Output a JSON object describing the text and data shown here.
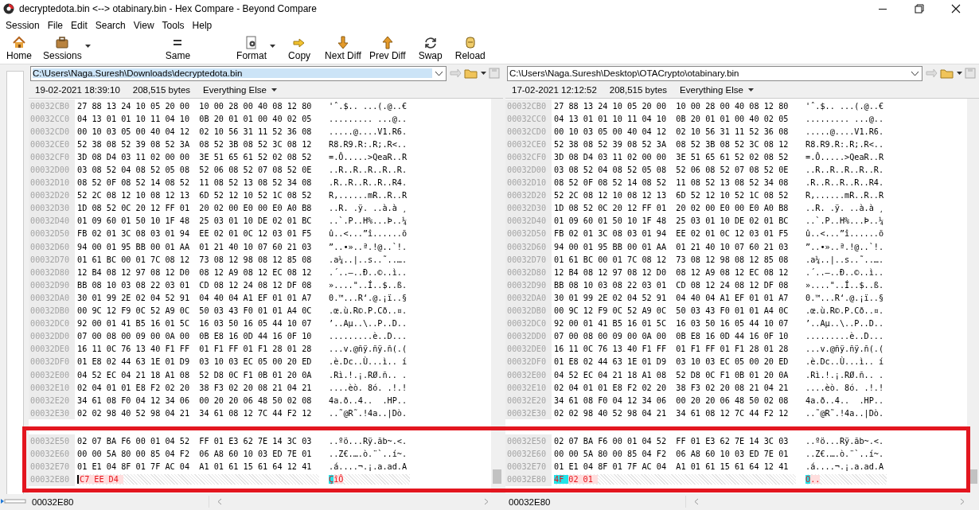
{
  "window": {
    "title": "decryptedota.bin <--> otabinary.bin - Hex Compare - Beyond Compare"
  },
  "menu": [
    "Session",
    "File",
    "Edit",
    "Search",
    "View",
    "Tools",
    "Help"
  ],
  "toolbar": [
    {
      "label": "Home",
      "dropdown": false
    },
    {
      "label": "Sessions",
      "dropdown": true
    },
    {
      "label": "Same",
      "dropdown": false
    },
    {
      "label": "Format",
      "dropdown": true
    },
    {
      "label": "Copy",
      "dropdown": false
    },
    {
      "label": "Next Diff",
      "dropdown": false
    },
    {
      "label": "Prev Diff",
      "dropdown": false
    },
    {
      "label": "Swap",
      "dropdown": false
    },
    {
      "label": "Reload",
      "dropdown": false
    }
  ],
  "panes": [
    {
      "path": "C:\\Users\\Naga.Suresh\\Downloads\\decryptedota.bin",
      "path_selected": true,
      "date": "19-02-2021 18:39:10",
      "size": "208,515 bytes",
      "format": "Everything Else",
      "rows": [
        {
          "offset": "00032CB0",
          "hex": "27 88 13 24 10 05 20 00  10 00 28 00 40 08 12 80",
          "text": "'ˆ.$.. ...(.@..€"
        },
        {
          "offset": "00032CC0",
          "hex": "04 13 01 01 10 11 04 10  0B 20 01 01 00 40 02 05",
          "text": "......... ...@.."
        },
        {
          "offset": "00032CD0",
          "hex": "00 10 03 05 00 40 04 12  02 10 56 31 11 52 36 08",
          "text": ".....@....V1.R6."
        },
        {
          "offset": "00032CE0",
          "hex": "52 38 08 52 39 08 52 3A  08 52 3B 08 52 3C 08 12",
          "text": "R8.R9.R:.R;.R<.."
        },
        {
          "offset": "00032CF0",
          "hex": "3D 08 D4 03 11 02 00 00  3E 51 65 61 52 02 08 52",
          "text": "=.Ô.....>QeaR..R"
        },
        {
          "offset": "00032D00",
          "hex": "03 08 52 04 08 52 05 08  52 06 08 52 07 08 52 0E",
          "text": "..R..R..R..R..R."
        },
        {
          "offset": "00032D10",
          "hex": "08 52 0F 08 52 14 08 52  11 08 52 13 08 52 34 08",
          "text": ".R..R..R..R..R4."
        },
        {
          "offset": "00032D20",
          "hex": "52 2C 08 12 10 08 12 13  6D 52 12 10 52 1C 08 52",
          "text": "R,......mR..R..R"
        },
        {
          "offset": "00032D30",
          "hex": "1D 08 52 0C 20 12 FF 01  20 02 00 E0 00 E0 A0 B8",
          "text": "..R. .ÿ. ..à.à ¸"
        },
        {
          "offset": "00032D40",
          "hex": "01 09 60 01 50 10 1F 48  25 03 01 10 DE 02 01 BC",
          "text": "..`.P..H%...Þ..¼"
        },
        {
          "offset": "00032D50",
          "hex": "FB 02 01 3C 08 03 01 94  EE 02 01 0C 12 03 01 F5",
          "text": "û..<...”î......õ"
        },
        {
          "offset": "00032D60",
          "hex": "94 00 01 95 BB 00 01 AA  01 21 40 10 07 60 21 03",
          "text": "”..•»..ª.!@..`!."
        },
        {
          "offset": "00032D70",
          "hex": "01 61 BC 00 01 7C 08 12  73 08 12 98 08 12 85 08",
          "text": ".a¼..|..s..˜..…."
        },
        {
          "offset": "00032D80",
          "hex": "12 B4 08 12 97 08 12 D0  08 12 A9 08 12 EC 08 12",
          "text": ".´..—..Ð..©..ì.."
        },
        {
          "offset": "00032D90",
          "hex": "BB 08 10 03 08 22 03 01  CD 08 12 24 08 12 DF 08",
          "text": "»....\"..Í..$..ß."
        },
        {
          "offset": "00032DA0",
          "hex": "30 01 99 2E 02 04 52 91  04 40 04 A1 EF 01 01 A7",
          "text": "0.™...R‘.@.¡ï..§"
        },
        {
          "offset": "00032DB0",
          "hex": "00 9C 12 F9 0C 52 A9 0C  50 03 43 F0 01 01 A4 0C",
          "text": ".œ.ù.R©.P.Cð..¤."
        },
        {
          "offset": "00032DC0",
          "hex": "92 00 01 41 B5 16 01 5C  16 03 50 16 05 44 10 07",
          "text": "’..Aµ..\\..P..D.."
        },
        {
          "offset": "00032DD0",
          "hex": "07 00 08 00 09 00 0A 00  0B E8 16 0D 44 16 0F 10",
          "text": ".........è..D..."
        },
        {
          "offset": "00032DE0",
          "hex": "16 11 0C 76 13 40 F1 FF  01 F1 FF 01 F1 28 01 28",
          "text": "...v.@ñÿ.ñÿ.ñ(.("
        },
        {
          "offset": "00032DF0",
          "hex": "01 E8 02 44 63 1E 01 D9  03 10 03 EC 05 00 20 ED",
          "text": ".è.Dc..Ù...ì.. í"
        },
        {
          "offset": "00032E00",
          "hex": "04 52 EC 04 21 18 A1 08  52 D8 0C F1 0B 01 20 0A",
          "text": ".Rì.!.¡.RØ.ñ.. ."
        },
        {
          "offset": "00032E10",
          "hex": "02 04 01 01 E8 F2 02 20  38 F3 02 20 08 21 04 21",
          "text": "....èò. 8ó. .!.!"
        },
        {
          "offset": "00032E20",
          "hex": "34 61 08 F0 04 12 34 06  00 20 20 06 48 50 02 08",
          "text": "4a.ð..4..  .HP.."
        },
        {
          "offset": "00032E30",
          "hex": "02 02 98 40 52 98 04 21  34 61 08 12 7C 44 F2 12",
          "text": "..˜@R˜.!4a..|Dò."
        }
      ],
      "framed_rows": [
        {
          "kind": "same",
          "offset": "00032E50",
          "hex": "02 07 BA F6 00 01 04 52  FF 01 E3 62 7E 14 3C 03",
          "text": "..ºö...Rÿ.ãb~.<."
        },
        {
          "kind": "same",
          "offset": "00032E60",
          "hex": "00 00 5A 80 00 85 04 F2  06 A8 60 10 03 ED 7E 01",
          "text": "..Z€.….ò.¨`..í~."
        },
        {
          "kind": "same",
          "offset": "00032E70",
          "hex": "01 E1 04 8F 01 7F AC 04  A1 01 61 15 61 64 12 41",
          "text": ".á....¬.¡.a.ad.A"
        },
        {
          "kind": "diff",
          "offset": "00032E80",
          "bytes": [
            {
              "text": "C7",
              "diff": true,
              "cursor": false,
              "caret": true
            },
            {
              "text": "EE",
              "diff": true,
              "cursor": false,
              "caret": false
            },
            {
              "text": "D4",
              "diff": true,
              "cursor": false,
              "caret": false
            }
          ],
          "chars": [
            {
              "text": "Ç",
              "diff": true,
              "cursor": true,
              "caret": false
            },
            {
              "text": "î",
              "diff": true,
              "cursor": false,
              "caret": false
            },
            {
              "text": "Ô",
              "diff": true,
              "cursor": false,
              "caret": false
            }
          ]
        }
      ],
      "status": "00032E80"
    },
    {
      "path": "C:\\Users\\Naga.Suresh\\Desktop\\OTACrypto\\otabinary.bin",
      "path_selected": false,
      "date": "17-02-2021 12:12:52",
      "size": "208,515 bytes",
      "format": "Everything Else",
      "rows": [
        {
          "offset": "00032CB0",
          "hex": "27 88 13 24 10 05 20 00  10 00 28 00 40 08 12 80",
          "text": "'ˆ.$.. ...(.@..€"
        },
        {
          "offset": "00032CC0",
          "hex": "04 13 01 01 10 11 04 10  0B 20 01 01 00 40 02 05",
          "text": "......... ...@.."
        },
        {
          "offset": "00032CD0",
          "hex": "00 10 03 05 00 40 04 12  02 10 56 31 11 52 36 08",
          "text": ".....@....V1.R6."
        },
        {
          "offset": "00032CE0",
          "hex": "52 38 08 52 39 08 52 3A  08 52 3B 08 52 3C 08 12",
          "text": "R8.R9.R:.R;.R<.."
        },
        {
          "offset": "00032CF0",
          "hex": "3D 08 D4 03 11 02 00 00  3E 51 65 61 52 02 08 52",
          "text": "=.Ô.....>QeaR..R"
        },
        {
          "offset": "00032D00",
          "hex": "03 08 52 04 08 52 05 08  52 06 08 52 07 08 52 0E",
          "text": "..R..R..R..R..R."
        },
        {
          "offset": "00032D10",
          "hex": "08 52 0F 08 52 14 08 52  11 08 52 13 08 52 34 08",
          "text": ".R..R..R..R..R4."
        },
        {
          "offset": "00032D20",
          "hex": "52 2C 08 12 10 08 12 13  6D 52 12 10 52 1C 08 52",
          "text": "R,......mR..R..R"
        },
        {
          "offset": "00032D30",
          "hex": "1D 08 52 0C 20 12 FF 01  20 02 00 E0 00 E0 A0 B8",
          "text": "..R. .ÿ. ..à.à ¸"
        },
        {
          "offset": "00032D40",
          "hex": "01 09 60 01 50 10 1F 48  25 03 01 10 DE 02 01 BC",
          "text": "..`.P..H%...Þ..¼"
        },
        {
          "offset": "00032D50",
          "hex": "FB 02 01 3C 08 03 01 94  EE 02 01 0C 12 03 01 F5",
          "text": "û..<...”î......õ"
        },
        {
          "offset": "00032D60",
          "hex": "94 00 01 95 BB 00 01 AA  01 21 40 10 07 60 21 03",
          "text": "”..•»..ª.!@..`!."
        },
        {
          "offset": "00032D70",
          "hex": "01 61 BC 00 01 7C 08 12  73 08 12 98 08 12 85 08",
          "text": ".a¼..|..s..˜..…."
        },
        {
          "offset": "00032D80",
          "hex": "12 B4 08 12 97 08 12 D0  08 12 A9 08 12 EC 08 12",
          "text": ".´..—..Ð..©..ì.."
        },
        {
          "offset": "00032D90",
          "hex": "BB 08 10 03 08 22 03 01  CD 08 12 24 08 12 DF 08",
          "text": "»....\"..Í..$..ß."
        },
        {
          "offset": "00032DA0",
          "hex": "30 01 99 2E 02 04 52 91  04 40 04 A1 EF 01 01 A7",
          "text": "0.™...R‘.@.¡ï..§"
        },
        {
          "offset": "00032DB0",
          "hex": "00 9C 12 F9 0C 52 A9 0C  50 03 43 F0 01 01 A4 0C",
          "text": ".œ.ù.R©.P.Cð..¤."
        },
        {
          "offset": "00032DC0",
          "hex": "92 00 01 41 B5 16 01 5C  16 03 50 16 05 44 10 07",
          "text": "’..Aµ..\\..P..D.."
        },
        {
          "offset": "00032DD0",
          "hex": "07 00 08 00 09 00 0A 00  0B E8 16 0D 44 16 0F 10",
          "text": ".........è..D..."
        },
        {
          "offset": "00032DE0",
          "hex": "16 11 0C 76 13 40 F1 FF  01 F1 FF 01 F1 28 01 28",
          "text": "...v.@ñÿ.ñÿ.ñ(.("
        },
        {
          "offset": "00032DF0",
          "hex": "01 E8 02 44 63 1E 01 D9  03 10 03 EC 05 00 20 ED",
          "text": ".è.Dc..Ù...ì.. í"
        },
        {
          "offset": "00032E00",
          "hex": "04 52 EC 04 21 18 A1 08  52 D8 0C F1 0B 01 20 0A",
          "text": ".Rì.!.¡.RØ.ñ.. ."
        },
        {
          "offset": "00032E10",
          "hex": "02 04 01 01 E8 F2 02 20  38 F3 02 20 08 21 04 21",
          "text": "....èò. 8ó. .!.!"
        },
        {
          "offset": "00032E20",
          "hex": "34 61 08 F0 04 12 34 06  00 20 20 06 48 50 02 08",
          "text": "4a.ð..4..  .HP.."
        },
        {
          "offset": "00032E30",
          "hex": "02 02 98 40 52 98 04 21  34 61 08 12 7C 44 F2 12",
          "text": "..˜@R˜.!4a..|Dò."
        }
      ],
      "framed_rows": [
        {
          "kind": "same",
          "offset": "00032E50",
          "hex": "02 07 BA F6 00 01 04 52  FF 01 E3 62 7E 14 3C 03",
          "text": "..ºö...Rÿ.ãb~.<."
        },
        {
          "kind": "same",
          "offset": "00032E60",
          "hex": "00 00 5A 80 00 85 04 F2  06 A8 60 10 03 ED 7E 01",
          "text": "..Z€.….ò.¨`..í~."
        },
        {
          "kind": "same",
          "offset": "00032E70",
          "hex": "01 E1 04 8F 01 7F AC 04  A1 01 61 15 61 64 12 41",
          "text": ".á....¬.¡.a.ad.A"
        },
        {
          "kind": "diff",
          "offset": "00032E80",
          "bytes": [
            {
              "text": "4F",
              "diff": true,
              "cursor": true,
              "caret": false
            },
            {
              "text": "02",
              "diff": true,
              "cursor": false,
              "caret": false
            },
            {
              "text": "01",
              "diff": true,
              "cursor": false,
              "caret": false
            }
          ],
          "chars": [
            {
              "text": "O",
              "diff": true,
              "cursor": true,
              "caret": false
            },
            {
              "text": ".",
              "diff": true,
              "cursor": false,
              "caret": false
            },
            {
              "text": ".",
              "diff": true,
              "cursor": false,
              "caret": false
            }
          ]
        }
      ],
      "status": "00032E80"
    }
  ]
}
